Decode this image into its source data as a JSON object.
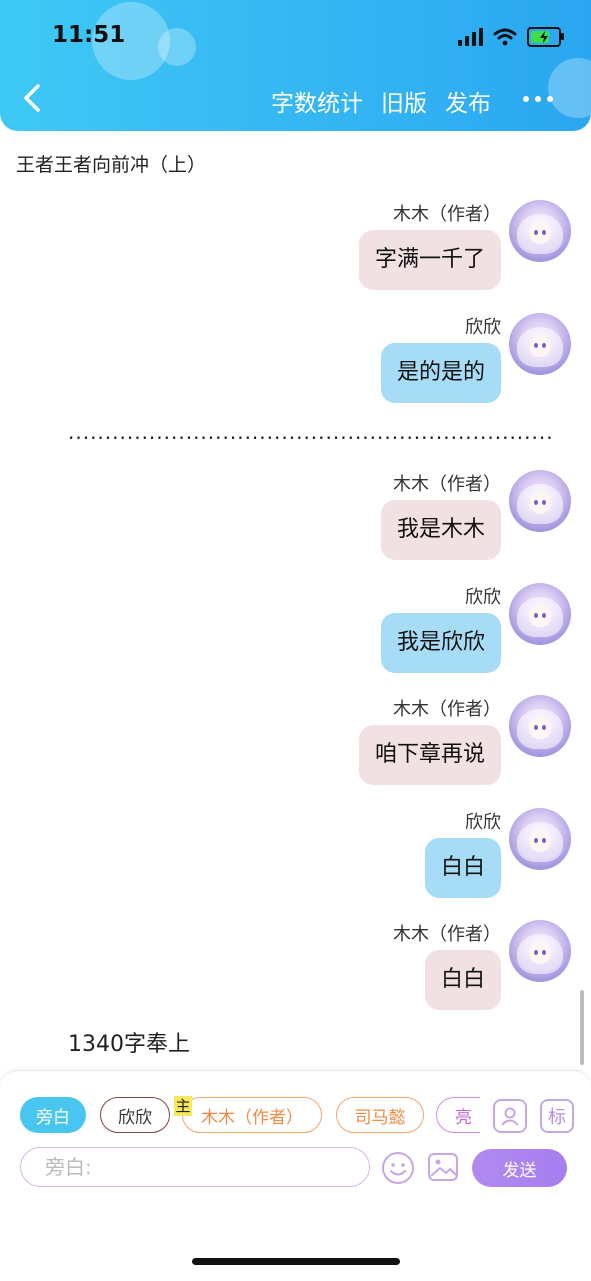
{
  "status_bar": {
    "time": "11:51"
  },
  "header": {
    "actions": [
      "字数统计",
      "旧版",
      "发布"
    ]
  },
  "chapter_title": "王者王者向前冲（上）",
  "messages": [
    {
      "speaker": "木木（作者）",
      "text": "字满一千了",
      "style": "pink"
    },
    {
      "speaker": "欣欣",
      "text": "是的是的",
      "style": "blue"
    },
    {
      "speaker": "木木（作者）",
      "text": "我是木木",
      "style": "pink"
    },
    {
      "speaker": "欣欣",
      "text": "我是欣欣",
      "style": "blue"
    },
    {
      "speaker": "木木（作者）",
      "text": "咱下章再说",
      "style": "pink"
    },
    {
      "speaker": "欣欣",
      "text": "白白",
      "style": "blue"
    },
    {
      "speaker": "木木（作者）",
      "text": "白白",
      "style": "pink"
    }
  ],
  "divider_dots": "..................................................................",
  "word_count_note": "1340字奉上",
  "composer": {
    "roles": [
      "旁白",
      "欣欣",
      "木木（作者）",
      "司马懿",
      "亮"
    ],
    "main_tag": "主",
    "label_button": "标",
    "input_placeholder": "旁白:",
    "send_label": "发送"
  },
  "colors": {
    "header": "#36b7f3",
    "author_bubble": "#f2e1e3",
    "reader_bubble": "#a7dcf7",
    "send": "#a77ef0"
  }
}
